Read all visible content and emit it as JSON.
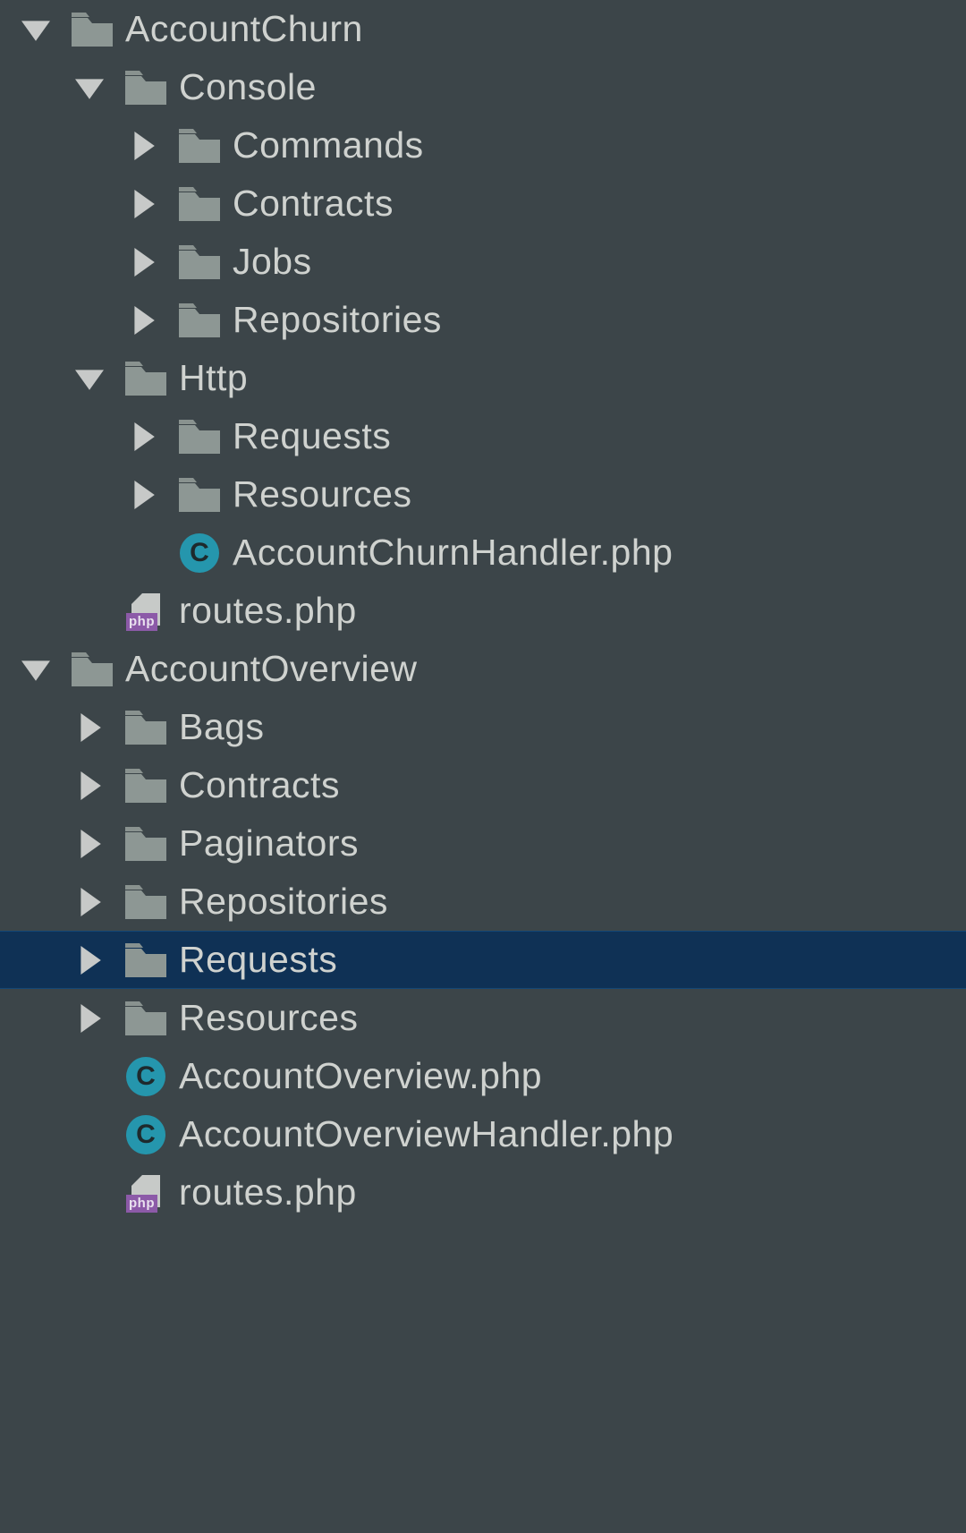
{
  "tree": {
    "accountChurn": {
      "label": "AccountChurn",
      "console": {
        "label": "Console",
        "commands": {
          "label": "Commands"
        },
        "contracts": {
          "label": "Contracts"
        },
        "jobs": {
          "label": "Jobs"
        },
        "repositories": {
          "label": "Repositories"
        }
      },
      "http": {
        "label": "Http",
        "requests": {
          "label": "Requests"
        },
        "resources": {
          "label": "Resources"
        },
        "handlerFile": {
          "label": "AccountChurnHandler.php"
        }
      },
      "routesFile": {
        "label": "routes.php"
      }
    },
    "accountOverview": {
      "label": "AccountOverview",
      "bags": {
        "label": "Bags"
      },
      "contracts": {
        "label": "Contracts"
      },
      "paginators": {
        "label": "Paginators"
      },
      "repositories": {
        "label": "Repositories"
      },
      "requests": {
        "label": "Requests"
      },
      "resources": {
        "label": "Resources"
      },
      "overviewFile": {
        "label": "AccountOverview.php"
      },
      "handlerFile": {
        "label": "AccountOverviewHandler.php"
      },
      "routesFile": {
        "label": "routes.php"
      }
    }
  },
  "icons": {
    "classBadge": "C",
    "phpTag": "php"
  }
}
